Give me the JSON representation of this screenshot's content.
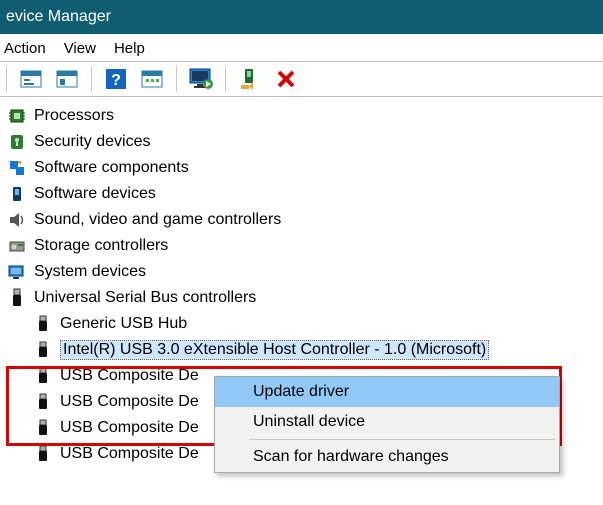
{
  "titlebar": {
    "title": "evice Manager"
  },
  "menubar": {
    "items": [
      "Action",
      "View",
      "Help"
    ]
  },
  "toolbar": {
    "icons": [
      "tool-properties-icon",
      "tool-help-icon",
      "tool-pane-icon",
      "tool-monitor-icon",
      "tool-scan-icon",
      "tool-delete-icon"
    ]
  },
  "tree": {
    "categories": [
      {
        "label": "Processors",
        "icon": "processor-icon"
      },
      {
        "label": "Security devices",
        "icon": "security-icon"
      },
      {
        "label": "Software components",
        "icon": "software-comp-icon"
      },
      {
        "label": "Software devices",
        "icon": "software-dev-icon"
      },
      {
        "label": "Sound, video and game controllers",
        "icon": "sound-icon"
      },
      {
        "label": "Storage controllers",
        "icon": "storage-icon"
      },
      {
        "label": "System devices",
        "icon": "system-icon"
      },
      {
        "label": "Universal Serial Bus controllers",
        "icon": "usb-icon"
      }
    ],
    "usb_children": [
      {
        "label": "Generic USB Hub"
      },
      {
        "label": "Intel(R) USB 3.0 eXtensible Host Controller - 1.0 (Microsoft)",
        "selected": true
      },
      {
        "label": "USB Composite De"
      },
      {
        "label": "USB Composite De"
      },
      {
        "label": "USB Composite De"
      },
      {
        "label": "USB Composite De"
      }
    ]
  },
  "context_menu": {
    "items": [
      {
        "label": "Update driver",
        "highlight": true
      },
      {
        "label": "Uninstall device"
      }
    ],
    "scan_label": "Scan for hardware changes"
  }
}
